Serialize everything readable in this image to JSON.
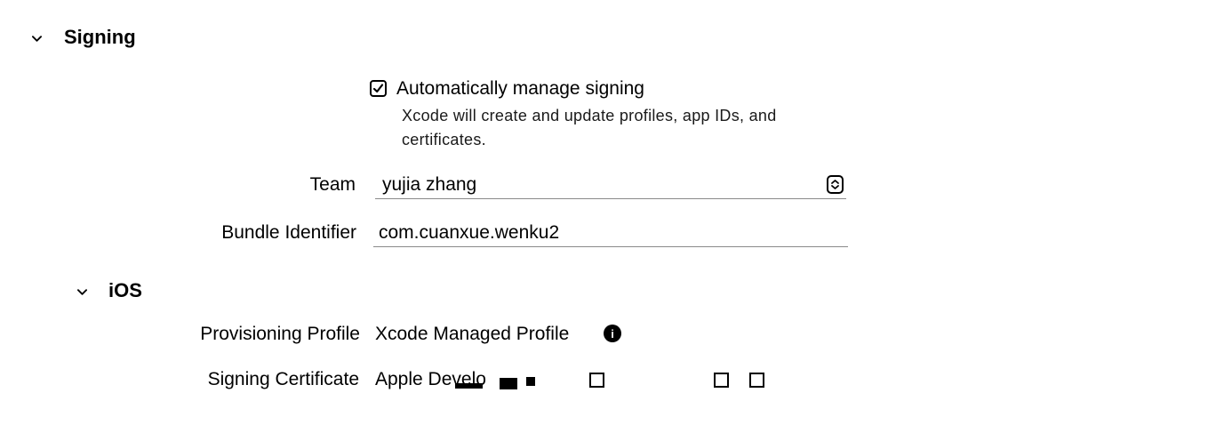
{
  "signing": {
    "title": "Signing",
    "auto_manage": {
      "label": "Automatically manage signing",
      "checked": true,
      "hint_line1": "Xcode will create and update profiles, app IDs, and",
      "hint_line2": "certificates."
    },
    "team": {
      "label": "Team",
      "value": "yujia zhang"
    },
    "bundle": {
      "label": "Bundle Identifier",
      "value": "com.cuanxue.wenku2"
    }
  },
  "ios": {
    "title": "iOS",
    "provisioning": {
      "label": "Provisioning Profile",
      "value": "Xcode Managed Profile",
      "info_glyph": "i"
    },
    "certificate": {
      "label": "Signing Certificate",
      "value": "Apple Develo"
    }
  },
  "icons": {
    "disclosure": "chevron-down-icon",
    "checkbox": "checkmark-icon",
    "stepper": "popup-stepper-icon",
    "info": "info-icon"
  }
}
